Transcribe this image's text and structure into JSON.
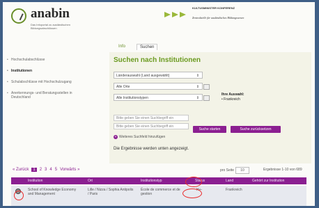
{
  "header": {
    "brand": "anabin",
    "brand_subtitle": "Das Infoportal zu ausländischen Bildungsabschlüssen",
    "kmk_title": "KULTUSMINISTER KONFERENZ",
    "kmk_subtitle": "Zentralstelle für ausländisches Bildungswesen"
  },
  "tabs": [
    {
      "label": "Info"
    },
    {
      "label": "Suchen"
    }
  ],
  "sidebar": {
    "items": [
      {
        "label": "Hochschulabschlüsse"
      },
      {
        "label": "Institutionen"
      },
      {
        "label": "Schulabschlüsse mit Hochschulzugang"
      },
      {
        "label": "Anerkennungs- und Beratungsstellen in Deutschland"
      }
    ]
  },
  "search": {
    "title": "Suchen nach Institutionen",
    "country_select": "Länderauswahl (Land ausgewählt)",
    "city_select": "Alle Orte",
    "type_select": "Alle Institutionstypen",
    "selection_title": "Ihre Auswahl:",
    "selection_item": "Frankreich",
    "search_placeholder_1": "Bitte geben Sie einen Suchbegriff ein",
    "search_placeholder_2": "Bitte geben Sie einen Suchbegriff ein",
    "start_button": "Suche starten",
    "reset_button": "Suche zurücksetzen",
    "add_field": "Weiteres Suchfeld hinzufügen",
    "results_message": "Die Ergebnisse werden unten angezeigt."
  },
  "pagination": {
    "prev": "« Zurück",
    "pages": [
      "1",
      "2",
      "3",
      "4",
      "5"
    ],
    "current_page": "1",
    "next": "Vorwärts »",
    "per_page_label": "pro Seite",
    "per_page_value": "10",
    "range_text": "Ergebnisse 1-10 von 689"
  },
  "table": {
    "headers": [
      "Institution",
      "Ort",
      "Institutionstyp",
      "Status",
      "Land",
      "Gehört zur Institution"
    ],
    "rows": [
      {
        "institution": "School of Knowledge Economy and Management",
        "place": "Lille / Nizza / Sophia Antipolis / Paris",
        "type": "École de commerce et de gestion",
        "status": "H+-",
        "country": "Frankreich",
        "parent": ""
      }
    ]
  },
  "colors": {
    "accent": "#8b1f91",
    "green": "#6a9a1f",
    "annotation": "#ea2a2a"
  }
}
